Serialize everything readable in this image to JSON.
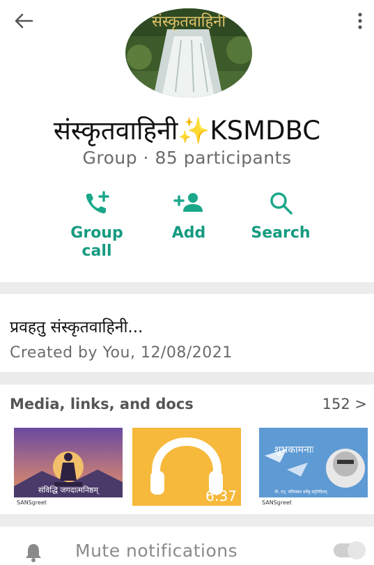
{
  "group": {
    "name": "संस्कृतवाहिनी✨KSMDBC",
    "meta": "Group · 85 participants",
    "avatar_text": "संस्कृतवाहिनी"
  },
  "actions": [
    {
      "label": "Group\ncall",
      "icon": "phone-add-icon"
    },
    {
      "label": "Add",
      "icon": "person-add-icon"
    },
    {
      "label": "Search",
      "icon": "search-icon"
    }
  ],
  "description": {
    "text": "प्रवहतु संस्कृतवाहिनी...",
    "created": "Created by You, 12/08/2021"
  },
  "media": {
    "heading": "Media, links, and docs",
    "count": "152 >",
    "thumbs": [
      {
        "caption": "संविद्धि जगदात्मनिष्ठम्",
        "brand": "SANSgreet"
      },
      {
        "duration": "6:37"
      },
      {
        "caption": "शुभकामनाः",
        "subcaption": "पी. एन्. पणिक्कर वर्येषु स्मृतिदिनम्",
        "brand": "SANSgreet"
      }
    ]
  },
  "mute": {
    "label": "Mute notifications"
  },
  "colors": {
    "accent": "#1aa78a",
    "audio_bg": "#f6b93b",
    "separator": "#ececec"
  }
}
